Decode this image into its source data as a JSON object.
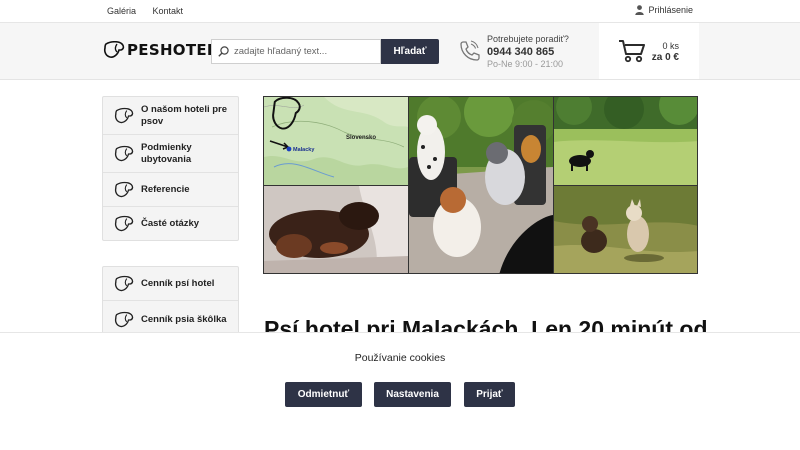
{
  "topbar": {
    "nav": [
      {
        "label": "Galéria"
      },
      {
        "label": "Kontakt"
      }
    ],
    "login_label": "Prihlásenie"
  },
  "header": {
    "logo_text": "PESHOTEL",
    "search_placeholder": "zadajte hľadaný text...",
    "search_button": "Hľadať",
    "contact_title": "Potrebujete poradiť?",
    "contact_phone": "0944 340 865",
    "contact_hours": "Po-Ne 9:00 - 21:00",
    "cart_count": "0 ks",
    "cart_total": "za 0 €"
  },
  "sidebar": {
    "group1": [
      {
        "label": "O našom hoteli pre psov"
      },
      {
        "label": "Podmienky ubytovania"
      },
      {
        "label": "Referencie"
      },
      {
        "label": "Časté otázky"
      }
    ],
    "group2": [
      {
        "label": "Cenník psí hotel"
      },
      {
        "label": "Cenník psia škôlka"
      }
    ]
  },
  "hero": {
    "map_label_country": "Slovensko",
    "map_label_city": "Malacky"
  },
  "main": {
    "heading": "Psí hotel pri Malackách. Len 20 minút od"
  },
  "cookies": {
    "title": "Používanie cookies",
    "reject": "Odmietnuť",
    "settings": "Nastavenia",
    "accept": "Prijať"
  },
  "colors": {
    "button_dark": "#2e3346",
    "header_bg": "#f6f6f6",
    "sidebar_bg": "#f4f4f4"
  }
}
